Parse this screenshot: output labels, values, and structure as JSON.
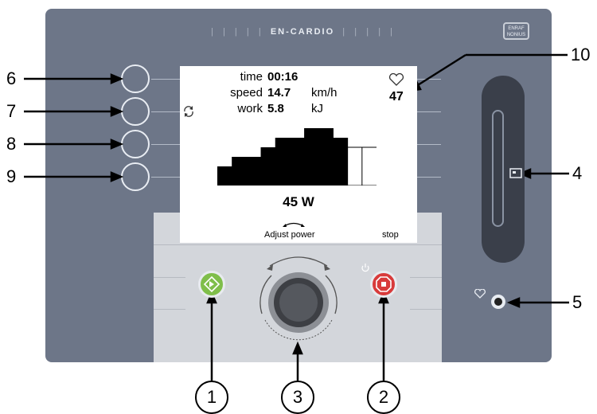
{
  "brand": "EN-CARDIO",
  "logo_text": "ENRAF NONIUS",
  "screen": {
    "labels": [
      "time",
      "speed",
      "work"
    ],
    "values": [
      "00:16",
      "14.7",
      "5.8"
    ],
    "units": [
      "",
      "km/h",
      "kJ"
    ],
    "heart_rate": "47",
    "power": "45  W",
    "adjust_label": "Adjust power",
    "stop_label": "stop"
  },
  "profile_levels": [
    2,
    3,
    3,
    4,
    5,
    5,
    6,
    6,
    5,
    4,
    4
  ],
  "callouts": {
    "left": [
      "6",
      "7",
      "8",
      "9"
    ],
    "right_top": "10",
    "right_mid": "4",
    "right_low": "5",
    "bottom": [
      "1",
      "3",
      "2"
    ]
  },
  "colors": {
    "panel": "#6d7688",
    "start_button": "#7fbe4a",
    "stop_button": "#d83b3b"
  },
  "icons": {
    "heart": "heart-icon",
    "refresh": "refresh-icon",
    "power": "power-icon",
    "start": "start-icon",
    "stop": "stop-icon",
    "card": "card-icon"
  }
}
